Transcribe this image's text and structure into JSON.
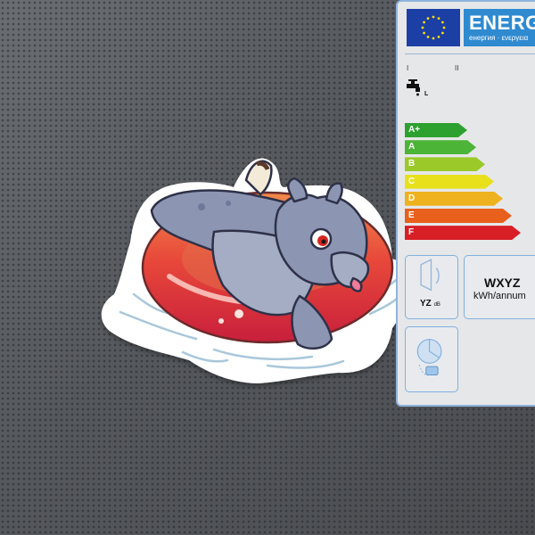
{
  "energy_label": {
    "title": "ENERG",
    "subtitle": "енергия · ενεργεια",
    "roman_1": "I",
    "roman_2": "II",
    "tap_unit": "L",
    "classes": [
      {
        "label": "A+",
        "color": "#2da12f"
      },
      {
        "label": "A",
        "color": "#4cb436"
      },
      {
        "label": "B",
        "color": "#9bc92a"
      },
      {
        "label": "C",
        "color": "#e8e01b"
      },
      {
        "label": "D",
        "color": "#eeb21e"
      },
      {
        "label": "E",
        "color": "#e8601c"
      },
      {
        "label": "F",
        "color": "#d81f26"
      }
    ],
    "noise_value": "YZ",
    "noise_unit": "dB",
    "energy_value": "WXYZ",
    "energy_unit": "kWh/annum"
  },
  "sticker": {
    "outline_color": "#ffffff",
    "ring_color": "#e23a36",
    "character_color": "#8c96b3"
  }
}
